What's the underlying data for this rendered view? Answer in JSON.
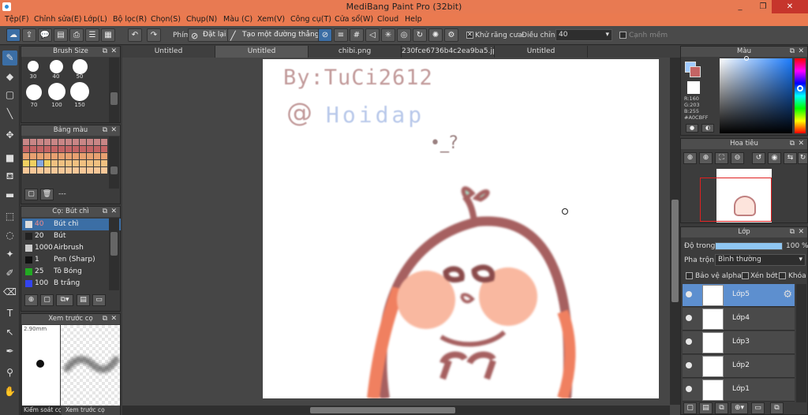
{
  "window": {
    "title": "MediBang Paint Pro (32bit)",
    "min": "_",
    "max": "❐",
    "close": "✕"
  },
  "menu": [
    "Tệp(F)",
    "Chỉnh sửa(E)",
    "Lớp(L)",
    "Bộ lọc(R)",
    "Chọn(S)",
    "Chụp(N)",
    "Màu (C)",
    "Xem(V)",
    "Công cụ(T)",
    "Cửa sổ(W)",
    "Cloud",
    "Help"
  ],
  "toolbar": {
    "snap_label": "Phím",
    "reset_label": "Đặt lại",
    "straight_label": "Tạo một đường thẳng",
    "antialias_label": "Khử răng cưa",
    "correction_label": "Điều chỉnh",
    "correction_value": "40",
    "canh_label": "Cạnh mềm"
  },
  "brush_size": {
    "title": "Brush Size",
    "sizes": [
      "30",
      "40",
      "50",
      "70",
      "100",
      "150"
    ]
  },
  "palette": {
    "title": "Bảng màu",
    "colors": [
      "#c98686",
      "#c98686",
      "#c98686",
      "#c98686",
      "#c98686",
      "#c98686",
      "#c98686",
      "#c98686",
      "#c98686",
      "#c98686",
      "#c98686",
      "#c98686",
      "#c46464",
      "#c46464",
      "#c46464",
      "#c46464",
      "#c46464",
      "#c46464",
      "#c46464",
      "#c46464",
      "#c46464",
      "#c46464",
      "#c46464",
      "#c46464",
      "#e8a070",
      "#e8a070",
      "#e8a070",
      "#e8a070",
      "#e8a070",
      "#e8a070",
      "#e8a070",
      "#e8a070",
      "#e8a070",
      "#e8a070",
      "#e8a070",
      "#e8a070",
      "#f0d060",
      "#f0d060",
      "#86a8e0",
      "#f0d060",
      "#f0c080",
      "#f0c080",
      "#f0c080",
      "#f0c080",
      "#f0c080",
      "#f0c080",
      "#f0c080",
      "#f0c080",
      "#f8c898",
      "#f8c898",
      "#f8c898",
      "#f8c898",
      "#f8c898",
      "#f8c898",
      "#f8c898",
      "#f8c898",
      "#f8c898",
      "#f8c898",
      "#f8c898",
      "#f8c898"
    ],
    "extra": "---"
  },
  "brushes": {
    "title": "Cọ: Bút chì",
    "items": [
      {
        "size": "40",
        "name": "Bút chì",
        "color": "#dddddd",
        "active": true
      },
      {
        "size": "20",
        "name": "Bút",
        "color": "#222222",
        "active": false
      },
      {
        "size": "1000",
        "name": "Airbrush",
        "color": "#cccccc",
        "active": false
      },
      {
        "size": "1",
        "name": "Pen (Sharp)",
        "color": "#111111",
        "active": false
      },
      {
        "size": "25",
        "name": "Tô Bóng",
        "color": "#22aa22",
        "active": false
      },
      {
        "size": "100",
        "name": "B trắng",
        "color": "#3344ee",
        "active": false
      }
    ]
  },
  "preview": {
    "title": "Xem trước cọ",
    "size": "2.90mm",
    "tab1": "Kiểm soát cọ",
    "tab2": "Xem trước cọ"
  },
  "tabs": [
    "Untitled",
    "Untitled",
    "chibi.png",
    "230fce6736b4c2ea9ba5.jpg",
    "Untitled"
  ],
  "canvas": {
    "line1": "By:TuCi2612",
    "line2_at": "@",
    "line2_word": "Hoidap",
    "face": "•_?"
  },
  "color_panel": {
    "title": "Màu",
    "r": "R:160",
    "g": "G:203",
    "b": "B:255",
    "hex": "#A0CBFF"
  },
  "navigator": {
    "title": "Hoa tiêu"
  },
  "layers": {
    "title": "Lớp",
    "opacity_label": "Độ trong",
    "opacity_value": "100 %",
    "opacity_fraction": 1.0,
    "blend_label": "Pha trộn",
    "blend_value": "Bình thường",
    "protect_label": "Bảo vệ alpha",
    "clip_label": "Xén bớt",
    "lock_label": "Khóa",
    "items": [
      "Lớp5",
      "Lớp4",
      "Lớp3",
      "Lớp2",
      "Lớp1"
    ]
  },
  "colors": {
    "accent": "#3b6ea5",
    "title": "#e87a52"
  }
}
